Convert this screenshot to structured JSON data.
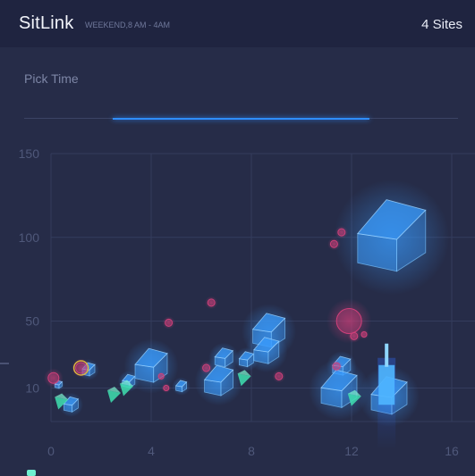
{
  "header": {
    "title": "SitLink",
    "subtitle": "WEEKEND,8 AM - 4AM",
    "sites": "4 Sites"
  },
  "filter": {
    "pick_time_label": "Pick Time",
    "range_start": 0.205,
    "range_end": 0.795
  },
  "colors": {
    "accent": "#2f8dff",
    "cube": "#3a9cff",
    "teal": "#3fe0b0",
    "magenta": "#d0407a",
    "gold": "#e0b040"
  },
  "chart_data": {
    "type": "scatter",
    "xlim": [
      0,
      16
    ],
    "ylim": [
      -10,
      150
    ],
    "x_ticks": [
      "0",
      "4",
      "8",
      "12",
      "16"
    ],
    "y_ticks": [
      "150",
      "100",
      "50",
      "10"
    ],
    "grid": true,
    "series": [
      {
        "marker": "cube",
        "color": "#3a9cff",
        "points": [
          {
            "x": 0.3,
            "y": 12,
            "s": 4
          },
          {
            "x": 0.8,
            "y": 0,
            "s": 8
          },
          {
            "x": 1.5,
            "y": 21,
            "s": 7
          },
          {
            "x": 3.1,
            "y": 14,
            "s": 7
          },
          {
            "x": 4.0,
            "y": 23,
            "s": 18
          },
          {
            "x": 5.2,
            "y": 11,
            "s": 6
          },
          {
            "x": 6.7,
            "y": 14,
            "s": 16
          },
          {
            "x": 6.9,
            "y": 28,
            "s": 10
          },
          {
            "x": 7.8,
            "y": 27,
            "s": 8
          },
          {
            "x": 8.7,
            "y": 44,
            "s": 18
          },
          {
            "x": 8.6,
            "y": 32,
            "s": 14
          },
          {
            "x": 11.6,
            "y": 23,
            "s": 10
          },
          {
            "x": 11.5,
            "y": 9,
            "s": 20
          },
          {
            "x": 13.5,
            "y": 5,
            "s": 20
          },
          {
            "x": 13.6,
            "y": 100,
            "s": 38
          }
        ]
      },
      {
        "marker": "pyramid",
        "color": "#3fe0b0",
        "points": [
          {
            "x": 0.4,
            "y": 2
          },
          {
            "x": 2.5,
            "y": 6
          },
          {
            "x": 3.0,
            "y": 10
          },
          {
            "x": 7.7,
            "y": 16
          },
          {
            "x": 12.1,
            "y": 4
          }
        ]
      },
      {
        "marker": "sphere",
        "color": "#d0407a",
        "points": [
          {
            "x": 0.1,
            "y": 16,
            "s": 6
          },
          {
            "x": 1.2,
            "y": 22,
            "s": 6
          },
          {
            "x": 4.4,
            "y": 17,
            "s": 3
          },
          {
            "x": 4.7,
            "y": 49,
            "s": 4
          },
          {
            "x": 4.6,
            "y": 10,
            "s": 3
          },
          {
            "x": 6.2,
            "y": 22,
            "s": 4
          },
          {
            "x": 6.4,
            "y": 61,
            "s": 4
          },
          {
            "x": 9.1,
            "y": 17,
            "s": 4
          },
          {
            "x": 11.3,
            "y": 96,
            "s": 4
          },
          {
            "x": 11.6,
            "y": 103,
            "s": 4
          },
          {
            "x": 11.9,
            "y": 50,
            "s": 14
          },
          {
            "x": 12.1,
            "y": 41,
            "s": 4
          },
          {
            "x": 12.5,
            "y": 42,
            "s": 3
          },
          {
            "x": 11.4,
            "y": 23,
            "s": 4
          }
        ]
      },
      {
        "marker": "bar",
        "color": "#4fb6ff",
        "points": [
          {
            "x": 13.4,
            "y": 0,
            "y2": 28
          }
        ]
      }
    ]
  }
}
